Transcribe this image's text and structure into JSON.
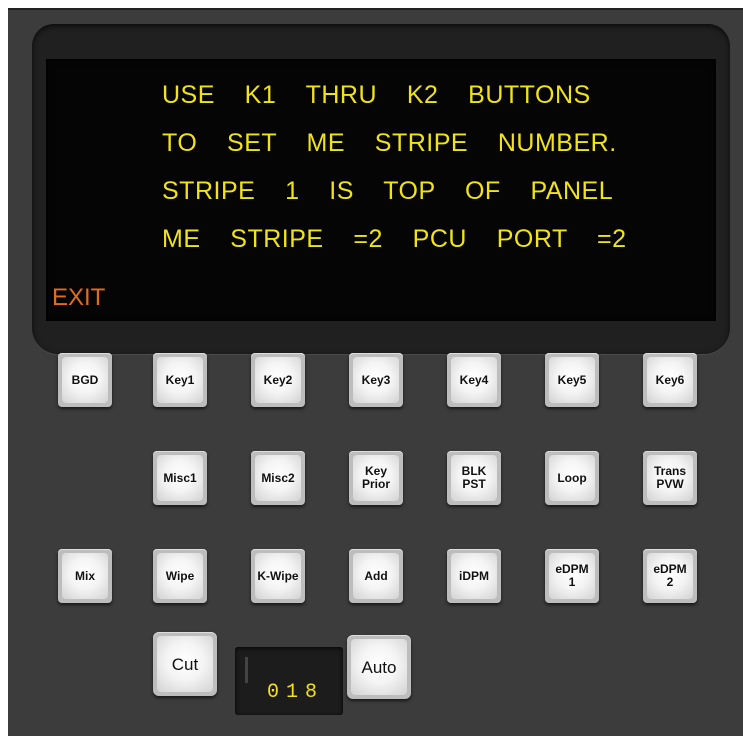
{
  "display": {
    "lines": [
      "USE    K1    THRU    K2    BUTTONS",
      "TO    SET    ME    STRIPE    NUMBER.",
      "STRIPE    1    IS    TOP    OF    PANEL",
      "ME    STRIPE    =2    PCU    PORT    =2"
    ],
    "exit_label": "EXIT"
  },
  "buttons": {
    "row1": [
      "BGD",
      "Key1",
      "Key2",
      "Key3",
      "Key4",
      "Key5",
      "Key6"
    ],
    "row2": [
      "Misc1",
      "Misc2",
      "Key\nPrior",
      "BLK\nPST",
      "Loop",
      "Trans\nPVW"
    ],
    "row3": [
      "Mix",
      "Wipe",
      "K-Wipe",
      "Add",
      "iDPM",
      "eDPM\n1",
      "eDPM\n2"
    ],
    "cut": "Cut",
    "auto": "Auto"
  },
  "counter": {
    "value": "018"
  },
  "colors": {
    "display_text": "#f1e21a",
    "exit_text": "#e36b1c",
    "panel": "#3c3c3c"
  }
}
